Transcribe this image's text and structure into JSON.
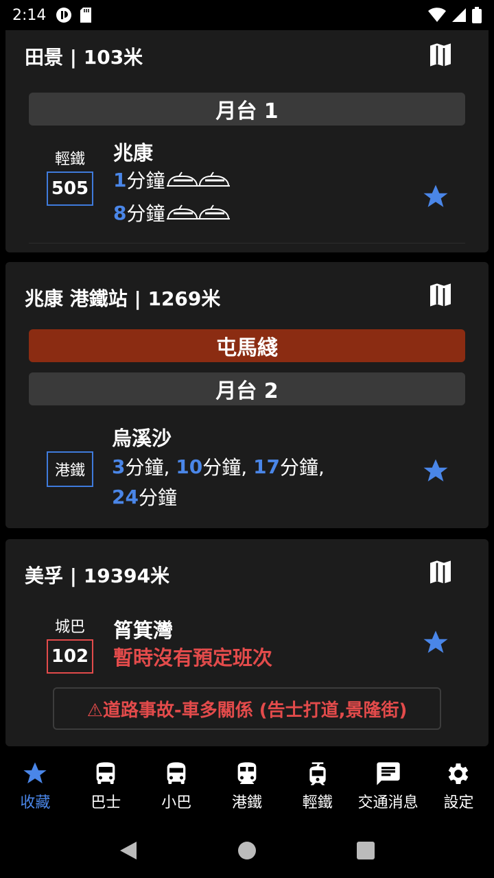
{
  "status_bar": {
    "time": "2:14"
  },
  "colors": {
    "accent": "#4a86e8",
    "alert": "#e34b4b",
    "line_tuen_ma": "#8b2c12",
    "card_bg": "#1c1c1c"
  },
  "stops": [
    {
      "title": "田景 | 103米",
      "platform": "月台 1",
      "route": {
        "type": "輕鐵",
        "number": "505",
        "destination": "兆康",
        "etas": [
          {
            "num": "1",
            "unit": "分鐘"
          },
          {
            "num": "8",
            "unit": "分鐘"
          }
        ]
      }
    },
    {
      "title": "兆康 港鐵站 | 1269米",
      "line": "屯馬綫",
      "platform": "月台 2",
      "route": {
        "badge": "港鐵",
        "destination": "烏溪沙",
        "eta_row1": [
          {
            "num": "3",
            "unit": "分鐘,"
          },
          {
            "num": "10",
            "unit": "分鐘,"
          },
          {
            "num": "17",
            "unit": "分鐘,"
          }
        ],
        "eta_row2": [
          {
            "num": "24",
            "unit": "分鐘"
          }
        ]
      }
    },
    {
      "title": "美孚 | 19394米",
      "route": {
        "type": "城巴",
        "number": "102",
        "destination": "筲箕灣",
        "status": "暫時沒有預定班次"
      },
      "notice": "⚠道路事故-車多關係 (告士打道,景隆街)"
    }
  ],
  "bottom_nav": [
    {
      "label": "收藏",
      "icon": "star-icon",
      "active": true
    },
    {
      "label": "巴士",
      "icon": "bus-icon"
    },
    {
      "label": "小巴",
      "icon": "minibus-icon"
    },
    {
      "label": "港鐵",
      "icon": "train-icon"
    },
    {
      "label": "輕鐵",
      "icon": "tram-icon"
    },
    {
      "label": "交通消息",
      "icon": "message-icon"
    },
    {
      "label": "設定",
      "icon": "gear-icon"
    }
  ]
}
